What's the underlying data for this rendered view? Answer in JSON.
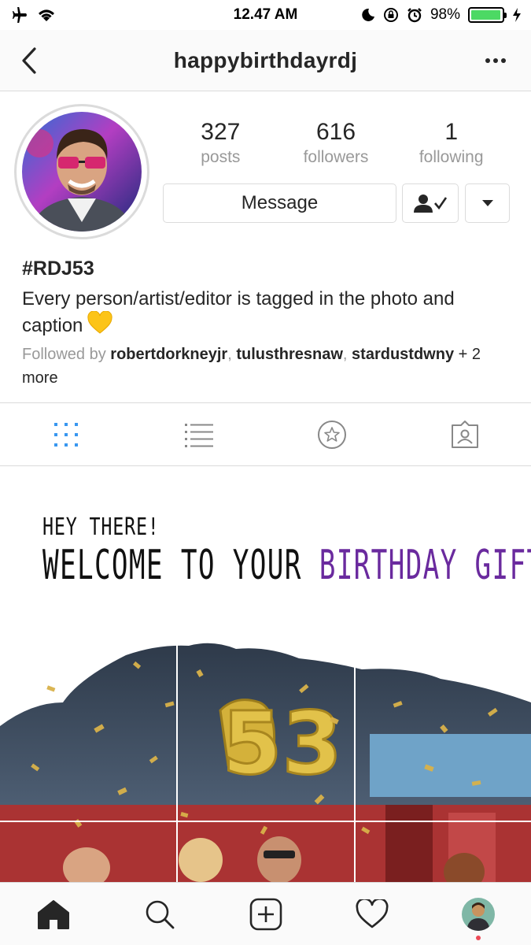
{
  "status_bar": {
    "time": "12.47 AM",
    "battery": "98%",
    "battery_level": 0.98,
    "icons": [
      "airplane-icon",
      "wifi-icon",
      "moon-icon",
      "rotation-lock-icon",
      "alarm-icon",
      "battery-icon",
      "charging-icon"
    ]
  },
  "header": {
    "title": "happybirthdayrdj",
    "back_icon": "chevron-left-icon",
    "more_icon": "ellipsis-icon"
  },
  "profile": {
    "stats": [
      {
        "value": "327",
        "label": "posts"
      },
      {
        "value": "616",
        "label": "followers"
      },
      {
        "value": "1",
        "label": "following"
      }
    ],
    "message_label": "Message",
    "follow_icon": "user-check-icon",
    "dropdown_icon": "caret-down-icon"
  },
  "bio": {
    "name": "#RDJ53",
    "text": "Every person/artist/editor is tagged in the photo and caption",
    "emoji_icon": "yellow-heart-icon",
    "followed_prefix": "Followed by",
    "followed_users": [
      "robertdorkneyjr",
      "tulusthresnaw",
      "stardustdwny"
    ],
    "followed_more": "+ 2 more"
  },
  "tabs": [
    {
      "icon": "grid-icon",
      "active": true
    },
    {
      "icon": "list-icon",
      "active": false
    },
    {
      "icon": "star-icon",
      "active": false
    },
    {
      "icon": "tagged-icon",
      "active": false
    }
  ],
  "post": {
    "line1": "HEY THERE!",
    "line2_a": "WELCOME TO YOUR ",
    "line2_b": "BIRTHDAY GIFT!",
    "balloon_text": "53"
  },
  "bottom_nav": [
    {
      "icon": "home-icon"
    },
    {
      "icon": "search-icon"
    },
    {
      "icon": "add-post-icon"
    },
    {
      "icon": "heart-icon"
    },
    {
      "icon": "profile-avatar-icon"
    }
  ],
  "colors": {
    "accent": "#3897f0",
    "purple_text": "#6a2a9e",
    "border": "#dbdbdb",
    "muted": "#999999",
    "battery_green": "#4cd964",
    "notification": "#ed4956"
  }
}
